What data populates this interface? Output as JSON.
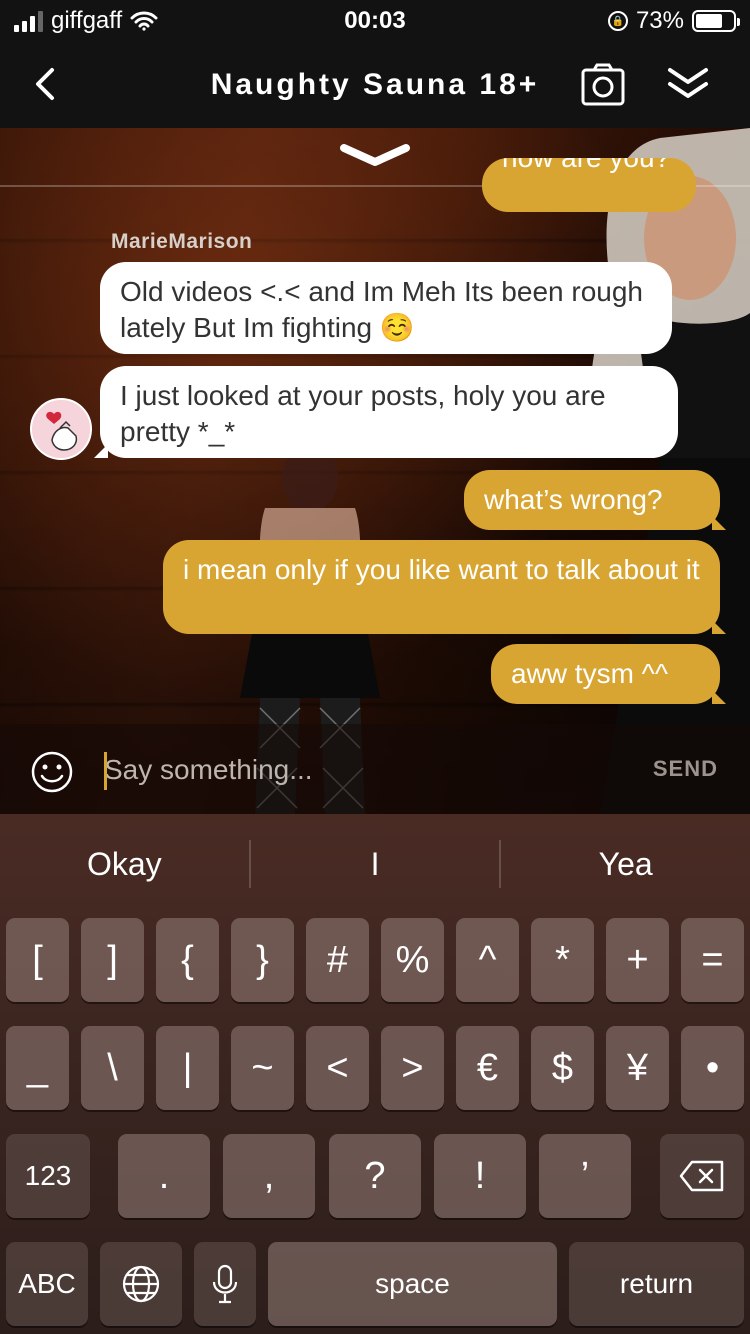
{
  "status_bar": {
    "carrier": "giffgaff",
    "time": "00:03",
    "battery_percent": "73%",
    "battery_level": 0.73
  },
  "header": {
    "title": "Naughty Sauna 18+",
    "back_icon": "chevron-left-icon",
    "camera_icon": "camera-icon",
    "collapse_icon": "double-chevron-down-icon"
  },
  "chat": {
    "partial_message": "how are you?",
    "sender_name": "MarieMarison",
    "messages": [
      {
        "from": "in",
        "text": "Old videos <.< and Im Meh Its been rough lately But Im fighting ☺️"
      },
      {
        "from": "in",
        "text": "I just looked at your posts, holy you are pretty *_*"
      },
      {
        "from": "out",
        "text": "what’s wrong?"
      },
      {
        "from": "out",
        "text": "i mean only if you like want to talk about it"
      },
      {
        "from": "out",
        "text": "aww tysm ^^"
      }
    ]
  },
  "input": {
    "placeholder": "Say something...",
    "send_label": "SEND",
    "emoji_icon": "smiley-icon"
  },
  "keyboard": {
    "suggestions": [
      "Okay",
      "I",
      "Yea"
    ],
    "row1": [
      "[",
      "]",
      "{",
      "}",
      "#",
      "%",
      "^",
      "*",
      "+",
      "="
    ],
    "row2": [
      "_",
      "\\",
      "|",
      "~",
      "<",
      ">",
      "€",
      "$",
      "¥",
      "•"
    ],
    "row3": [
      ".",
      ",",
      "?",
      "!",
      "’"
    ],
    "numbers_label": "123",
    "abc_label": "ABC",
    "space_label": "space",
    "return_label": "return",
    "globe_icon": "globe-icon",
    "mic_icon": "microphone-icon",
    "delete_icon": "backspace-icon"
  }
}
